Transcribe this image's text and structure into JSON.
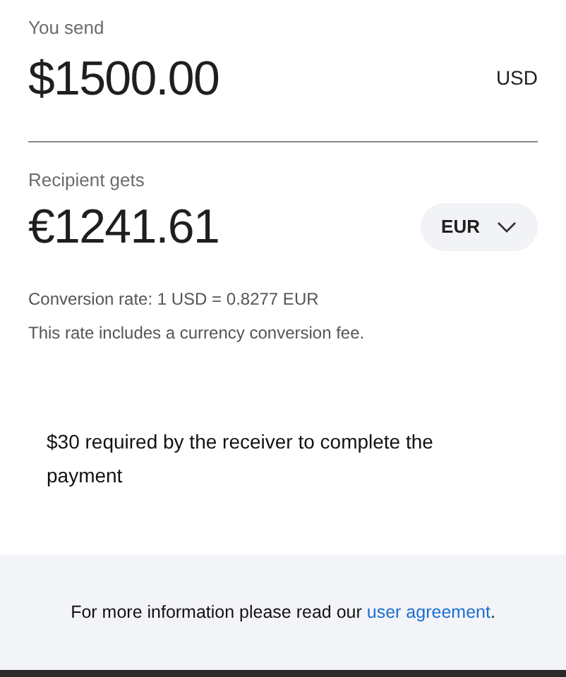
{
  "send": {
    "label": "You send",
    "amount": "$1500.00",
    "currency": "USD"
  },
  "receive": {
    "label": "Recipient gets",
    "amount": "€1241.61",
    "currency": "EUR"
  },
  "rate": "Conversion rate: 1 USD = 0.8277 EUR",
  "fee_note": "This rate includes a currency conversion fee.",
  "notice": "$30 required by the receiver to complete the payment",
  "footer": {
    "text": "For more information please read our ",
    "link": "user agreement",
    "after": "."
  }
}
